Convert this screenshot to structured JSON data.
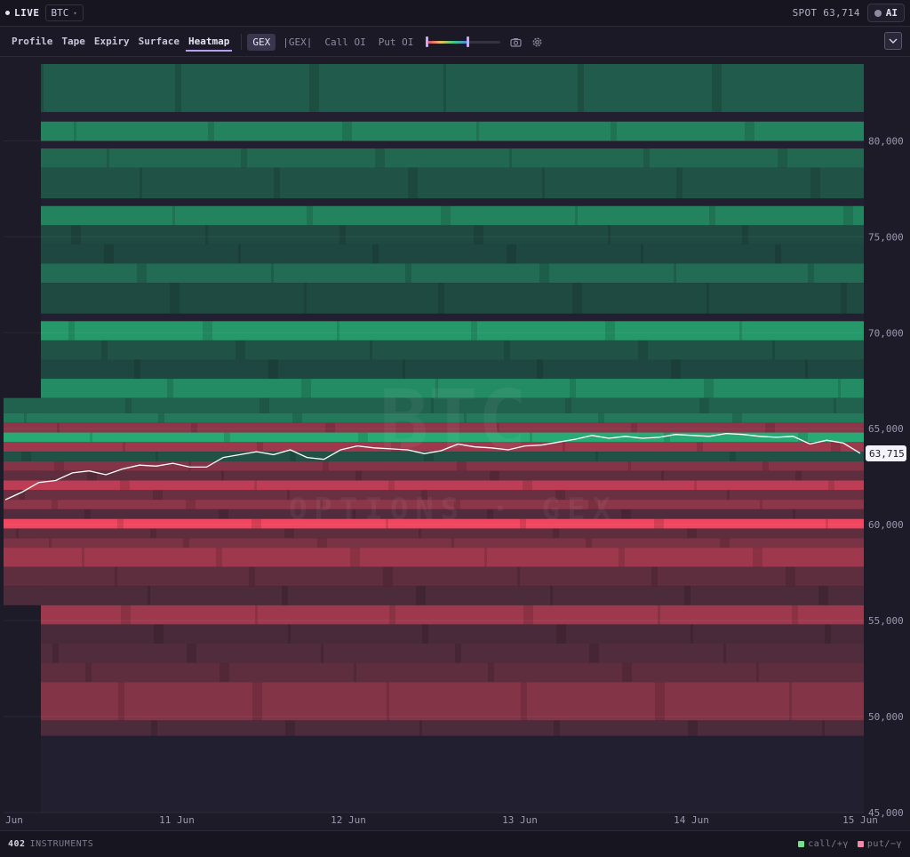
{
  "topbar": {
    "live_label": "LIVE",
    "symbol": "BTC",
    "spot_label": "SPOT 63,714",
    "ai_label": "AI"
  },
  "tabs": [
    {
      "label": "Profile",
      "active": false
    },
    {
      "label": "Tape",
      "active": false
    },
    {
      "label": "Expiry",
      "active": false
    },
    {
      "label": "Surface",
      "active": false
    },
    {
      "label": "Heatmap",
      "active": true
    }
  ],
  "metric_modes": [
    {
      "label": "GEX",
      "active": true
    },
    {
      "label": "|GEX|",
      "active": false
    },
    {
      "label": "Call OI",
      "active": false
    },
    {
      "label": "Put OI",
      "active": false
    }
  ],
  "intensity_slider": {
    "value": 0.55
  },
  "icons": {
    "snapshot": "camera-icon",
    "settings": "gear-icon",
    "menu": "chevron-down-icon"
  },
  "colors": {
    "positive": "#2fb57f",
    "negative": "#e8445f",
    "background": "#1d1b28",
    "accent": "#b79cf0"
  },
  "watermark": {
    "title": "BTC",
    "subtitle": "OPTIONS · GEX"
  },
  "chart_data": {
    "type": "heatmap",
    "y_ticks": [
      "80,000",
      "75,000",
      "70,000",
      "65,000",
      "60,000",
      "55,000",
      "50,000",
      "45,000"
    ],
    "x_ticks": [
      "Jun",
      "11 Jun",
      "12 Jun",
      "13 Jun",
      "14 Jun",
      "15 Jun"
    ],
    "ylim": [
      45000,
      84000
    ],
    "spot_marker": "63,715",
    "spot_value": 63715,
    "price_series": [
      61300,
      61700,
      62200,
      62300,
      62700,
      62800,
      62600,
      62900,
      63100,
      63050,
      63200,
      63000,
      63000,
      63500,
      63650,
      63800,
      63650,
      63900,
      63500,
      63400,
      63900,
      64100,
      64000,
      63950,
      63900,
      63700,
      63850,
      64200,
      64050,
      64000,
      63900,
      64100,
      64150,
      64300,
      64450,
      64650,
      64500,
      64600,
      64500,
      64550,
      64700,
      64650,
      64600,
      64750,
      64700,
      64600,
      64550,
      64600,
      64200,
      64400,
      64250,
      63715
    ],
    "bands": [
      {
        "lo": 81500,
        "hi": 84000,
        "v": 0.25
      },
      {
        "lo": 80000,
        "hi": 81000,
        "v": 0.55
      },
      {
        "lo": 78600,
        "hi": 79600,
        "v": 0.35
      },
      {
        "lo": 77000,
        "hi": 78600,
        "v": 0.18
      },
      {
        "lo": 75600,
        "hi": 76600,
        "v": 0.55
      },
      {
        "lo": 74600,
        "hi": 75600,
        "v": 0.12
      },
      {
        "lo": 73000,
        "hi": 74600,
        "v": 0.1
      },
      {
        "lo": 72600,
        "hi": 73600,
        "v": 0.38
      },
      {
        "lo": 71000,
        "hi": 72600,
        "v": 0.12
      },
      {
        "lo": 69600,
        "hi": 70600,
        "v": 0.72
      },
      {
        "lo": 68600,
        "hi": 69600,
        "v": 0.18
      },
      {
        "lo": 67600,
        "hi": 68600,
        "v": 0.1
      },
      {
        "lo": 66600,
        "hi": 67600,
        "v": 0.62
      },
      {
        "lo": 65800,
        "hi": 66600,
        "v": 0.3
      },
      {
        "lo": 65300,
        "hi": 65800,
        "v": 0.48
      },
      {
        "lo": 64800,
        "hi": 65300,
        "v": -0.45
      },
      {
        "lo": 64300,
        "hi": 64800,
        "v": 0.85
      },
      {
        "lo": 63800,
        "hi": 64300,
        "v": -0.55
      },
      {
        "lo": 63300,
        "hi": 63800,
        "v": 0.18
      },
      {
        "lo": 62800,
        "hi": 63300,
        "v": -0.4
      },
      {
        "lo": 62300,
        "hi": 62800,
        "v": -0.2
      },
      {
        "lo": 61800,
        "hi": 62300,
        "v": -0.72
      },
      {
        "lo": 61300,
        "hi": 61800,
        "v": -0.25
      },
      {
        "lo": 60800,
        "hi": 61300,
        "v": -0.45
      },
      {
        "lo": 60300,
        "hi": 60800,
        "v": -0.12
      },
      {
        "lo": 59800,
        "hi": 60300,
        "v": -1.0
      },
      {
        "lo": 59300,
        "hi": 59800,
        "v": -0.2
      },
      {
        "lo": 58800,
        "hi": 59300,
        "v": -0.35
      },
      {
        "lo": 57800,
        "hi": 58800,
        "v": -0.55
      },
      {
        "lo": 56800,
        "hi": 57800,
        "v": -0.2
      },
      {
        "lo": 55800,
        "hi": 56800,
        "v": -0.1
      },
      {
        "lo": 54800,
        "hi": 55800,
        "v": -0.55
      },
      {
        "lo": 53800,
        "hi": 54800,
        "v": -0.08
      },
      {
        "lo": 52800,
        "hi": 53800,
        "v": -0.12
      },
      {
        "lo": 51800,
        "hi": 52800,
        "v": -0.2
      },
      {
        "lo": 49800,
        "hi": 51800,
        "v": -0.4
      },
      {
        "lo": 49000,
        "hi": 49800,
        "v": -0.1
      }
    ]
  },
  "footer": {
    "instrument_count": "402",
    "instrument_label": "INSTRUMENTS",
    "legend": [
      {
        "label": "call/+γ",
        "color": "#7ddc8f"
      },
      {
        "label": "put/−γ",
        "color": "#f08aa8"
      }
    ]
  }
}
